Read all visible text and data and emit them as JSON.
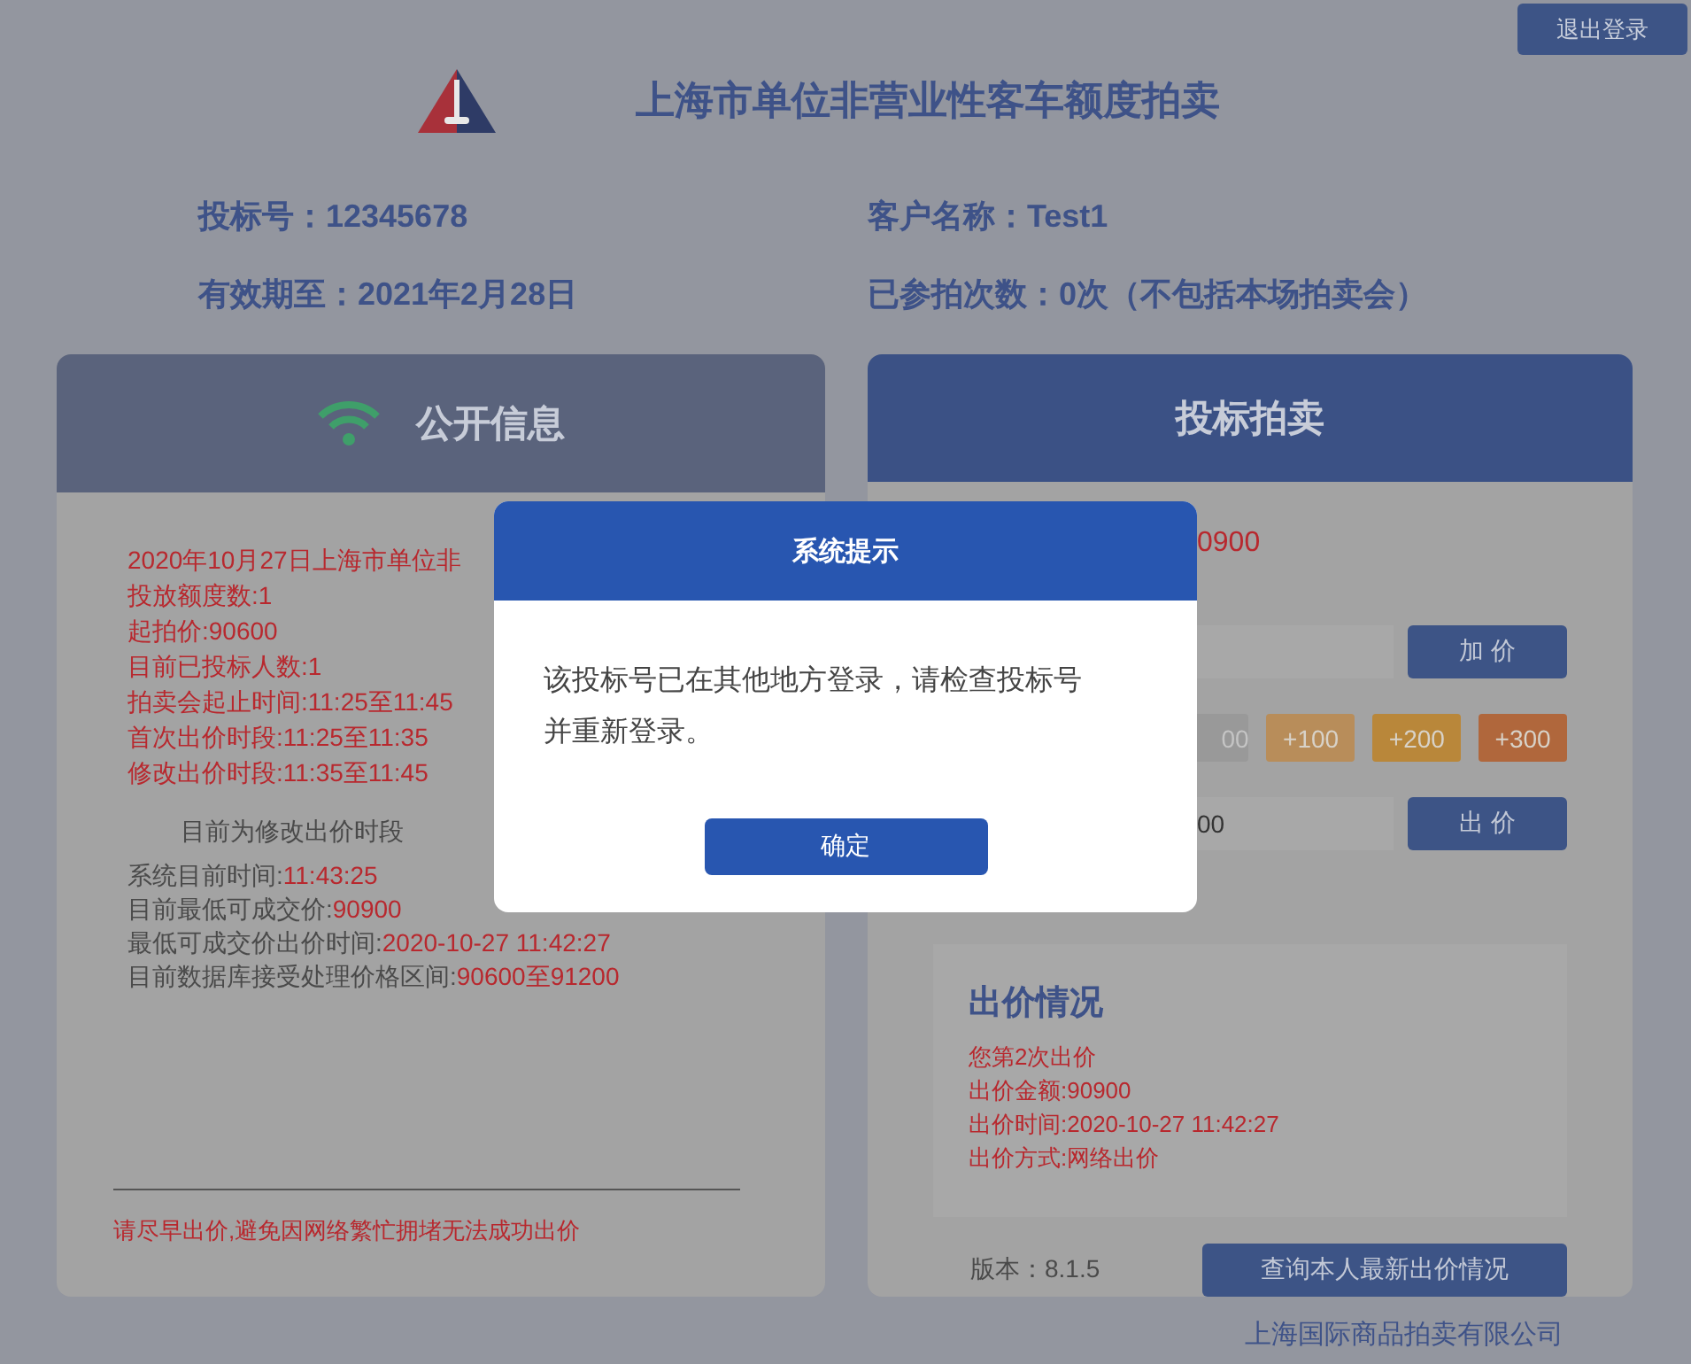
{
  "logout_button": "退出登录",
  "title": "上海市单位非营业性客车额度拍卖",
  "info": [
    "投标号：12345678",
    "客户名称：Test1",
    "有效期至：2021年2月28日",
    "已参拍次数：0次（不包括本场拍卖会）"
  ],
  "public_info": {
    "title": "公开信息",
    "auction_lines": [
      "2020年10月27日上海市单位非",
      "投放额度数:1",
      "起拍价:90600",
      "目前已投标人数:1",
      "拍卖会起止时间:11:25至11:45",
      "首次出价时段:11:25至11:35",
      "修改出价时段:11:35至11:45"
    ],
    "phase": "目前为修改出价时段",
    "status_lines": [
      {
        "label": "系统目前时间:",
        "value": "11:43:25"
      },
      {
        "label": "目前最低可成交价:",
        "value": "90900"
      },
      {
        "label": "最低可成交价出价时间:",
        "value": "2020-10-27 11:42:27"
      },
      {
        "label": "目前数据库接受处理价格区间:",
        "value": "90600至91200"
      }
    ],
    "notice": "请尽早出价,避免因网络繁忙拥堵无法成功出价"
  },
  "bidding": {
    "title": "投标拍卖",
    "price_partial": "0900",
    "raise_button": "加 价",
    "increments": [
      {
        "label": "00",
        "kind": "neutral"
      },
      {
        "label": "+100",
        "kind": "light"
      },
      {
        "label": "+200",
        "kind": "medium"
      },
      {
        "label": "+300",
        "kind": "strong"
      }
    ],
    "bid_field_value": "00",
    "bid_button": "出 价",
    "summary": {
      "title": "出价情况",
      "lines": [
        "您第2次出价",
        "出价金额:90900",
        "出价时间:2020-10-27 11:42:27",
        "出价方式:网络出价"
      ]
    },
    "version": "版本：8.1.5",
    "query_button": "查询本人最新出价情况"
  },
  "company": "上海国际商品拍卖有限公司",
  "dialog": {
    "title": "系统提示",
    "message": "该投标号已在其他地方登录，请检查投标号并重新登录。",
    "confirm_button": "确定"
  }
}
